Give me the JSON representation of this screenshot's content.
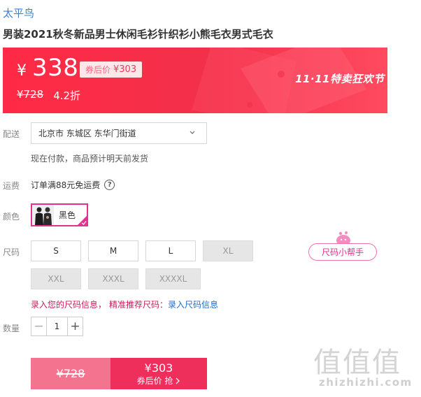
{
  "product": {
    "brand": "太平鸟",
    "title": "男装2021秋冬新品男士休闲毛衫针织衫小熊毛衣男式毛衣"
  },
  "price": {
    "currency": "¥",
    "current": "338",
    "coupon_label": "券后价",
    "coupon_value": "¥303",
    "original": "¥728",
    "discount": "4.2折",
    "promo_title": "11·11特卖狂欢节",
    "accent_color": "#ff2a45"
  },
  "delivery": {
    "label": "配送",
    "address": "北京市 东城区 东华门街道",
    "note": "现在付款，商品预计明天前发货"
  },
  "freight": {
    "label": "运费",
    "text": "订单满88元免运费",
    "help_icon": "help-circle-icon"
  },
  "color": {
    "label": "颜色",
    "option": "黑色",
    "selected": true,
    "highlight_color": "#e4308f"
  },
  "size": {
    "label": "尺码",
    "options": [
      {
        "label": "S",
        "available": true
      },
      {
        "label": "M",
        "available": true
      },
      {
        "label": "L",
        "available": true
      },
      {
        "label": "XL",
        "available": false
      },
      {
        "label": "XXL",
        "available": false
      },
      {
        "label": "XXXL",
        "available": false
      },
      {
        "label": "XXXXL",
        "available": false
      }
    ],
    "helper": "尺码小帮手",
    "info_part1": "录入您的尺码信息，",
    "info_part2": "精准推荐尺码：",
    "info_link": "录入尺码信息"
  },
  "quantity": {
    "label": "数量",
    "value": "1",
    "minus": "−",
    "plus": "+"
  },
  "buy": {
    "original_price": "¥728",
    "coupon_price": "¥303",
    "action_label": "券后价 抢"
  },
  "watermark": {
    "chars": "值值值",
    "domain": "zhizhizhi.com"
  }
}
